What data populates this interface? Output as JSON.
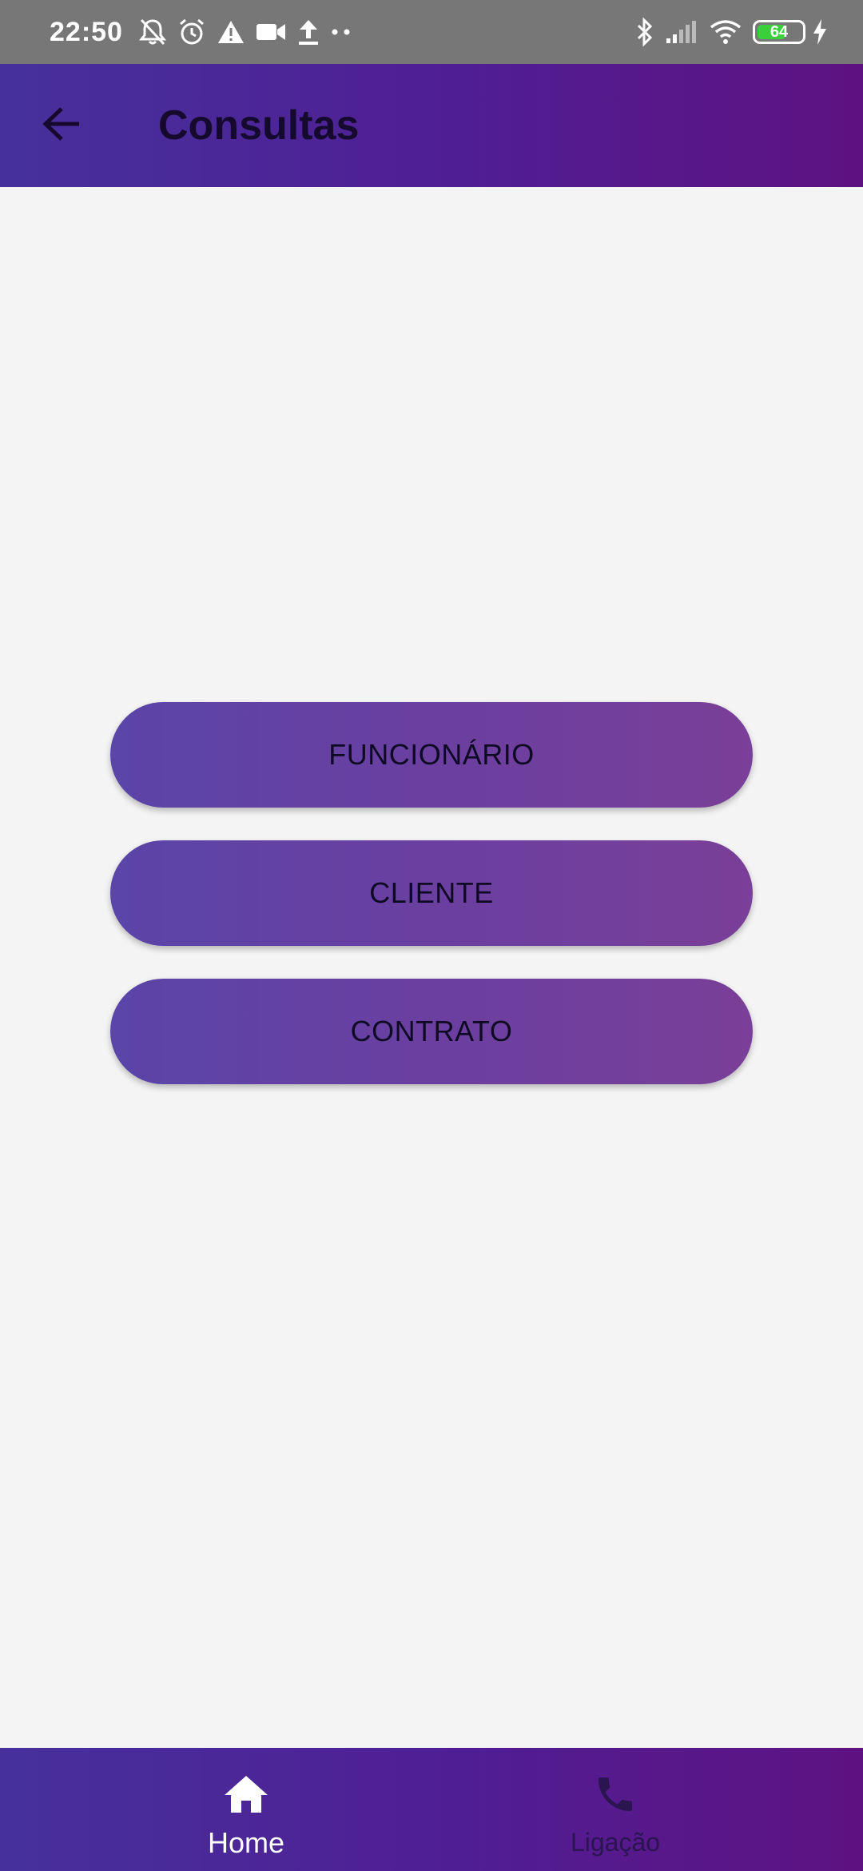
{
  "status_bar": {
    "time": "22:50",
    "battery_level": 64,
    "battery_text": "64",
    "icons_left": [
      "bell-off-icon",
      "alarm-icon",
      "warning-icon",
      "video-icon",
      "upload-icon",
      "more-dots-icon"
    ],
    "icons_right": [
      "bluetooth-icon",
      "signal-icon",
      "wifi-icon",
      "battery-icon",
      "charging-icon"
    ]
  },
  "app_bar": {
    "title": "Consultas",
    "back_icon": "arrow-left-icon",
    "gradient": [
      "#46319b",
      "#5e1281"
    ]
  },
  "menu": {
    "buttons": [
      {
        "label": "FUNCIONÁRIO"
      },
      {
        "label": "CLIENTE"
      },
      {
        "label": "CONTRATO"
      }
    ]
  },
  "bottom_nav": {
    "items": [
      {
        "label": "Home",
        "icon": "home-icon",
        "active": true
      },
      {
        "label": "Ligação",
        "icon": "phone-icon",
        "active": false
      }
    ]
  },
  "colors": {
    "background": "#f4f4f4",
    "status_bar": "#777777",
    "button_gradient": [
      "#5a45a8",
      "#7a3f98"
    ],
    "battery_fill": "#3ccf3c"
  }
}
